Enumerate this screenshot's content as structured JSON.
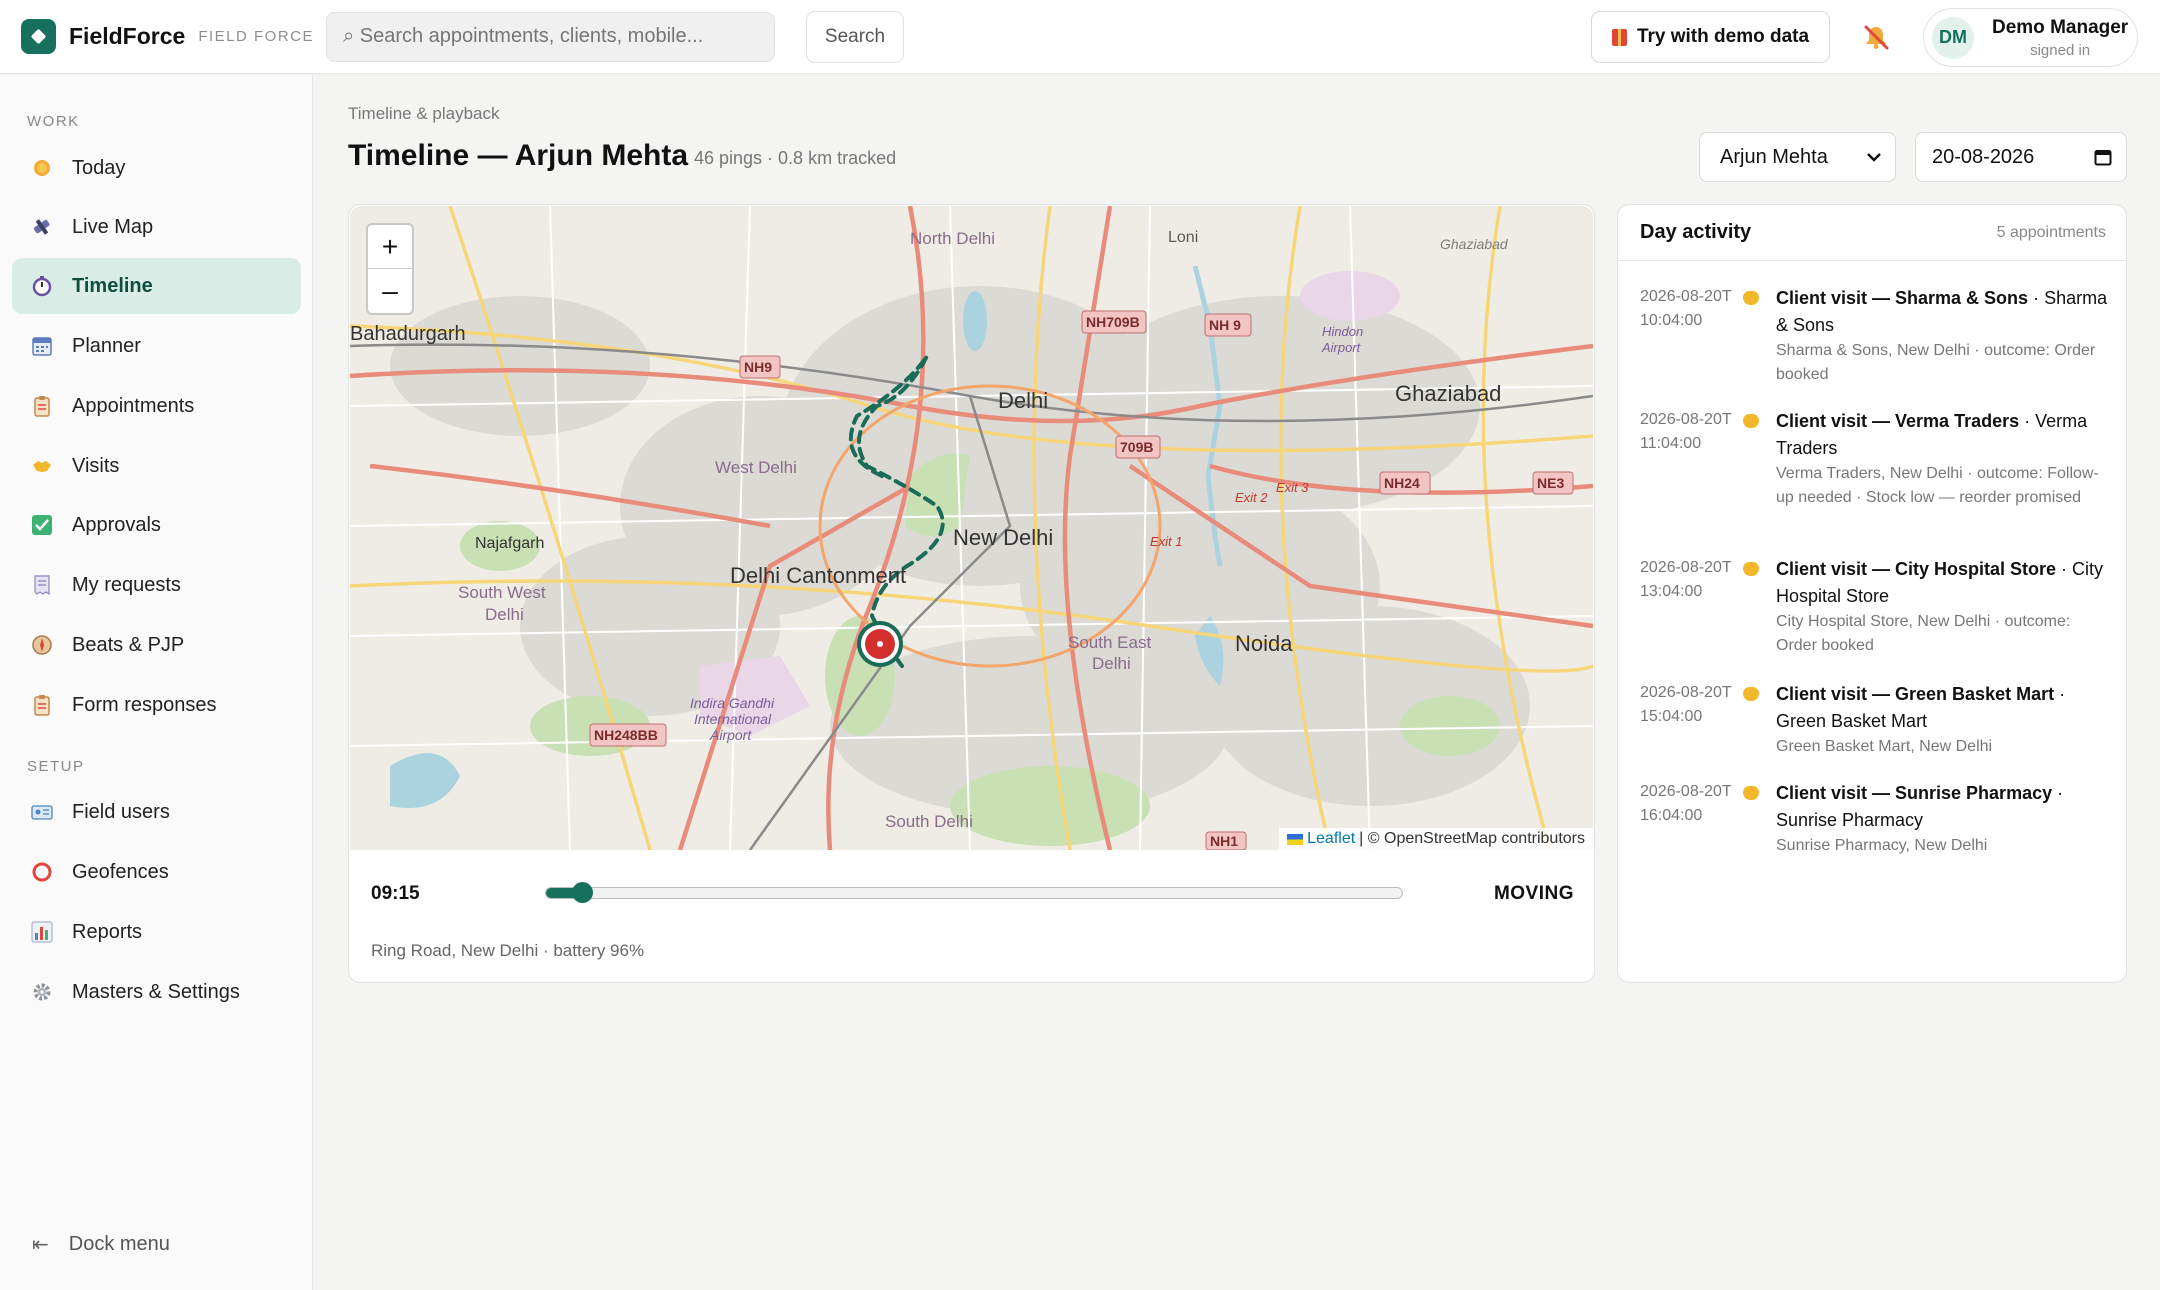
{
  "brand": {
    "name": "FieldForce",
    "tagline": "FIELD FORCE"
  },
  "search": {
    "placeholder": "⌕ Search appointments, clients, mobile...",
    "button": "Search"
  },
  "header": {
    "demo_button": "Try with demo data",
    "user_initials": "DM",
    "user_name": "Demo Manager",
    "user_status": "signed in"
  },
  "sidebar": {
    "work_label": "WORK",
    "setup_label": "SETUP",
    "items": [
      {
        "label": "Today",
        "icon": "sun-icon"
      },
      {
        "label": "Live Map",
        "icon": "satellite-icon"
      },
      {
        "label": "Timeline",
        "icon": "stopwatch-icon"
      },
      {
        "label": "Planner",
        "icon": "calendar-icon"
      },
      {
        "label": "Appointments",
        "icon": "clipboard-icon"
      },
      {
        "label": "Visits",
        "icon": "handshake-icon"
      },
      {
        "label": "Approvals",
        "icon": "check-icon"
      },
      {
        "label": "My requests",
        "icon": "receipt-icon"
      },
      {
        "label": "Beats & PJP",
        "icon": "compass-icon"
      },
      {
        "label": "Form responses",
        "icon": "form-icon"
      },
      {
        "label": "Field users",
        "icon": "id-card-icon"
      },
      {
        "label": "Geofences",
        "icon": "ring-icon"
      },
      {
        "label": "Reports",
        "icon": "bar-chart-icon"
      },
      {
        "label": "Masters & Settings",
        "icon": "gear-icon"
      }
    ],
    "active": "Timeline",
    "dock": "Dock menu"
  },
  "page": {
    "breadcrumb": "Timeline & playback",
    "title": "Timeline — Arjun Mehta",
    "subtitle": "46 pings · 0.8 km tracked",
    "user_select": "Arjun Mehta",
    "date": "20-08-2026"
  },
  "map": {
    "labels": [
      "North Delhi",
      "Loni",
      "Ghaziabad",
      "Bahadurgarh",
      "Delhi",
      "Ghaziabad",
      "West Delhi",
      "New Delhi",
      "Najafgarh",
      "Delhi Cantonment",
      "South West Delhi",
      "South East Delhi",
      "Noida",
      "Indira Gandhi International Airport",
      "South Delhi",
      "Hindon Airport",
      "Exit 2",
      "Exit 3",
      "Exit 1"
    ],
    "shields": [
      "NH709B",
      "NH 9",
      "NH9",
      "709B",
      "NH24",
      "NE3",
      "NH248BB",
      "NH1"
    ],
    "attribution_leaflet": "Leaflet",
    "attribution_rest": "| © OpenStreetMap contributors",
    "zoom_in": "+",
    "zoom_out": "–"
  },
  "playback": {
    "time": "09:15",
    "progress": 0.03,
    "state": "MOVING",
    "location": "Ring Road, New Delhi · battery 96%"
  },
  "activity": {
    "title": "Day activity",
    "count": "5 appointments",
    "items": [
      {
        "time": "2026-08-20T10:04:00",
        "title": "Client visit — Sharma & Sons",
        "client": "Sharma & Sons",
        "meta": "Sharma & Sons, New Delhi · outcome: Order booked"
      },
      {
        "time": "2026-08-20T11:04:00",
        "title": "Client visit — Verma Traders",
        "client": "Verma Traders",
        "meta": "Verma Traders, New Delhi · outcome: Follow-up needed · Stock low — reorder promised"
      },
      {
        "time": "2026-08-20T13:04:00",
        "title": "Client visit — City Hospital Store",
        "client": "City Hospital Store",
        "meta": "City Hospital Store, New Delhi · outcome: Order booked"
      },
      {
        "time": "2026-08-20T15:04:00",
        "title": "Client visit — Green Basket Mart",
        "client": "Green Basket Mart",
        "meta": "Green Basket Mart, New Delhi"
      },
      {
        "time": "2026-08-20T16:04:00",
        "title": "Client visit — Sunrise Pharmacy",
        "client": "Sunrise Pharmacy",
        "meta": "Sunrise Pharmacy, New Delhi"
      }
    ]
  },
  "colors": {
    "brand": "#17705c",
    "active_bg": "#d9ede6",
    "marker": "#d32f2f",
    "route": "#1a6b58"
  }
}
